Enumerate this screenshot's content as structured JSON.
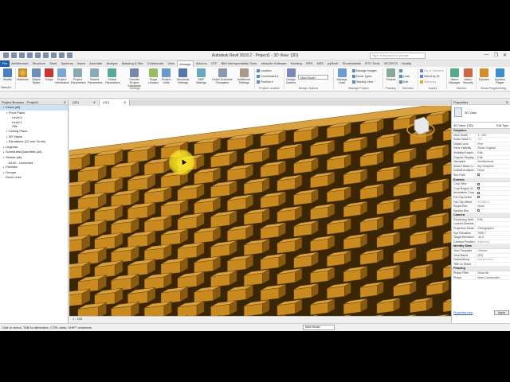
{
  "titlebar": {
    "title": "Autodesk Revit 2018.2 - Project1 - 3D View: {3D}",
    "search_placeholder": "Type a keyword or phrase",
    "win_min": "—",
    "win_max": "❐",
    "win_close": "✕"
  },
  "tabs": [
    "File",
    "Architecture",
    "Structure",
    "Steel",
    "Systems",
    "Insert",
    "Annotate",
    "Analyze",
    "Massing & Site",
    "Collaborate",
    "View",
    "Manage",
    "Add-Ins",
    "VTF",
    "BIM Interoperability Tools",
    "Infosuite Software",
    "Kiceling",
    "RRS",
    "NSS",
    "pyRevit",
    "Shoredrawitz",
    "RTV Tools",
    "ViCORTX",
    "Modify"
  ],
  "active_tab": "Manage",
  "ribbon": {
    "modify": "Modify",
    "select": "Select ▾",
    "materials": "Materials",
    "object_styles": "Object Styles",
    "snaps": "Snaps",
    "project_information": "Project Information",
    "project_parameters": "Project Parameters",
    "shared_parameters": "Shared Parameters",
    "global_parameters": "Global Parameters",
    "transfer_project_standards": "Transfer Project Standards",
    "purge_unused": "Purge Unused",
    "project_units": "Project Units",
    "structural_settings": "Structural Settings",
    "mep_settings": "MEP Settings",
    "panel_schedule_templates": "Panel Schedule Templates",
    "additional_settings": "Additional Settings",
    "settings_panel": "Settings",
    "location": "Location",
    "coordinates": "Coordinates ▾",
    "position": "Position ▾",
    "project_location_panel": "Project Location",
    "design_options": "Design Options",
    "main_model": "Main Model",
    "design_options_panel": "Design Options",
    "manage_links": "Manage Links",
    "manage_images": "Manage Images",
    "decal_types": "Decal Types",
    "starting_view": "Starting View",
    "manage_project_panel": "Manage Project",
    "phases": "Phases",
    "phasing_panel": "Phasing",
    "selection_panel": "Selection",
    "load": "Load",
    "edit": "Edit",
    "ids_of_selection": "IDs of Selection",
    "select_by_id": "Select by ID",
    "warnings": "Warnings",
    "inquiry_panel": "Inquiry",
    "macro_manager": "Macro Manager",
    "macro_security": "Macro Security",
    "macros_panel": "Macros",
    "dynamo": "Dynamo",
    "dynamo_player": "Dynamo Player",
    "visual_programming_panel": "Visual Programming"
  },
  "browser": {
    "title": "Project Browser - Project1",
    "close": "✕",
    "items": [
      {
        "label": "Views (all)",
        "indent": 1,
        "toggle": "▾",
        "selected": true
      },
      {
        "label": "Floor Plans",
        "indent": 2,
        "toggle": "▾"
      },
      {
        "label": "Level 0",
        "indent": 3,
        "toggle": ""
      },
      {
        "label": "Level 1",
        "indent": 3,
        "toggle": ""
      },
      {
        "label": "Site",
        "indent": 3,
        "toggle": ""
      },
      {
        "label": "Ceiling Plans",
        "indent": 2,
        "toggle": "▸"
      },
      {
        "label": "3D Views",
        "indent": 2,
        "toggle": "▸"
      },
      {
        "label": "Elevations (12-mm Circle)",
        "indent": 2,
        "toggle": "▸"
      },
      {
        "label": "Legends",
        "indent": 1,
        "toggle": "▸"
      },
      {
        "label": "Schedules/Quantities (all)",
        "indent": 1,
        "toggle": "▸"
      },
      {
        "label": "Sheets (all)",
        "indent": 1,
        "toggle": "▾"
      },
      {
        "label": "A100 - Unnamed",
        "indent": 2,
        "toggle": ""
      },
      {
        "label": "Families",
        "indent": 1,
        "toggle": "▸"
      },
      {
        "label": "Groups",
        "indent": 1,
        "toggle": "▸"
      },
      {
        "label": "Revit Links",
        "indent": 1,
        "toggle": ""
      }
    ]
  },
  "view_tabs": [
    {
      "label": "{3D}",
      "close": "✕",
      "active": false
    },
    {
      "label": "{3D}",
      "close": "✕",
      "active": true
    }
  ],
  "view_control": {
    "scale": "1 : 100"
  },
  "properties": {
    "title": "Properties",
    "close": "✕",
    "type_name": "3D View",
    "selector": "3D View: {3D}",
    "edit_type": "Edit Type",
    "groups": [
      {
        "name": "Graphics",
        "rows": [
          {
            "k": "View Scale",
            "v": "1 : 100"
          },
          {
            "k": "Scale Value 1:",
            "v": "100",
            "dim": true
          },
          {
            "k": "Detail Level",
            "v": "Fine"
          },
          {
            "k": "Parts Visibility",
            "v": "Show Original"
          },
          {
            "k": "Visibility/Graphi...",
            "v": "Edit..."
          },
          {
            "k": "Graphic Display...",
            "v": "Edit..."
          },
          {
            "k": "Discipline",
            "v": "Architectural"
          },
          {
            "k": "Show Hidden Li...",
            "v": "By Discipline"
          },
          {
            "k": "Default Analysis...",
            "v": "None"
          },
          {
            "k": "Sun Path",
            "v": "",
            "check": false
          }
        ]
      },
      {
        "name": "Extents",
        "rows": [
          {
            "k": "Crop View",
            "v": "",
            "check": false
          },
          {
            "k": "Crop Region Vi...",
            "v": "",
            "check": false
          },
          {
            "k": "Annotation Crop",
            "v": "",
            "check": false
          },
          {
            "k": "Far Clip Active",
            "v": "",
            "check": false
          },
          {
            "k": "Far Clip Offset",
            "v": "304800.0",
            "dim": true
          },
          {
            "k": "Scope Box",
            "v": "None"
          },
          {
            "k": "Section Box",
            "v": "",
            "check": false
          }
        ]
      },
      {
        "name": "Camera",
        "rows": [
          {
            "k": "Rendering Setti...",
            "v": "Edit..."
          },
          {
            "k": "Locked Orientat...",
            "v": "",
            "dim": true
          },
          {
            "k": "Projection Mode",
            "v": "Orthographic"
          },
          {
            "k": "Eye Elevation",
            "v": "7059.7"
          },
          {
            "k": "Target Elevation",
            "v": "-42.6"
          },
          {
            "k": "Camera Position",
            "v": "Adjusting",
            "dim": true
          }
        ]
      },
      {
        "name": "Identity Data",
        "rows": [
          {
            "k": "View Template",
            "v": "<None>"
          },
          {
            "k": "View Name",
            "v": "{3D}"
          },
          {
            "k": "Dependency",
            "v": "Independent",
            "dim": true
          },
          {
            "k": "Title on Sheet",
            "v": ""
          }
        ]
      },
      {
        "name": "Phasing",
        "rows": [
          {
            "k": "Phase Filter",
            "v": "Show All"
          },
          {
            "k": "Phase",
            "v": "New Construction"
          }
        ]
      }
    ],
    "help_link": "Properties help",
    "apply": "Apply"
  },
  "status": {
    "text": "Click to select, TAB for alternates, CTRL adds, SHIFT unselects.",
    "model": "Main Model"
  },
  "colors": {
    "brick_top": "#d9a13f",
    "brick_face": "#c98a20",
    "brick_side": "#8a5a10",
    "brick_shadow": "#3a2505",
    "file_tab": "#1f5ea8"
  }
}
